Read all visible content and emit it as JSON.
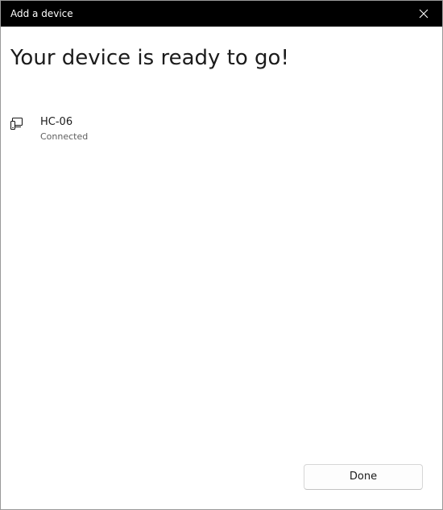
{
  "window": {
    "title": "Add a device"
  },
  "titlebar": {
    "close_icon": "close-icon"
  },
  "main": {
    "heading": "Your device is ready to go!",
    "device": {
      "icon": "devices-icon",
      "name": "HC-06",
      "status": "Connected"
    }
  },
  "footer": {
    "done_label": "Done"
  },
  "colors": {
    "titlebar_bg": "#000000",
    "titlebar_text": "#ffffff",
    "body_bg": "#ffffff",
    "primary_text": "#1b1b1b",
    "secondary_text": "#5e5e5e"
  }
}
